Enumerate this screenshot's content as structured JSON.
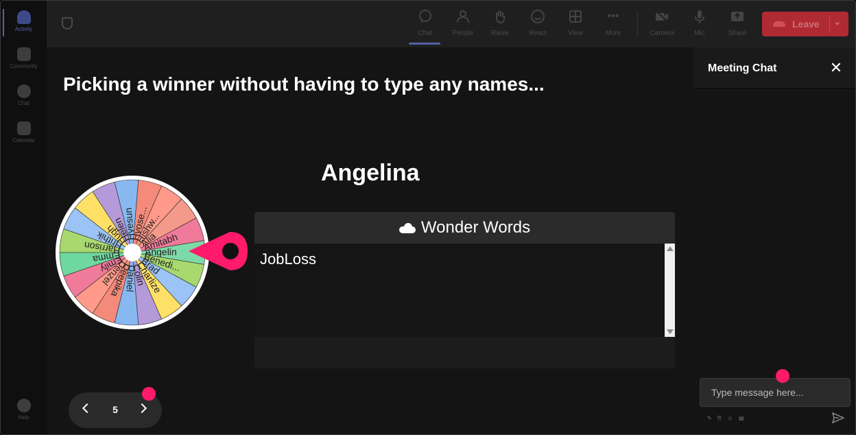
{
  "rail": {
    "items": [
      {
        "label": "Activity",
        "active": true
      },
      {
        "label": "Community"
      },
      {
        "label": "Chat"
      },
      {
        "label": "Calendar"
      }
    ],
    "help_label": "Help"
  },
  "toolbar": {
    "chat": "Chat",
    "people": "People",
    "raise": "Raise",
    "react": "React",
    "view": "View",
    "more": "More",
    "camera": "Camera",
    "mic": "Mic",
    "share": "Share",
    "leave": "Leave"
  },
  "stage": {
    "title": "Picking a winner without having to type any names...",
    "winner": "Angelina",
    "wheel": {
      "names": [
        "Angelin",
        "Benedi...",
        "Brad",
        "Charlize",
        "Colin",
        "Daniel",
        "Deepika",
        "Denzel",
        "Emily",
        "Emma",
        "Harrison",
        "Hrithik",
        "Hugh",
        "Helen",
        "Hyesun",
        "Hyose...",
        "Hishw...",
        "Alia",
        "Amitabh"
      ],
      "colors": [
        "#7ed9a8",
        "#a8d86e",
        "#9cc3f5",
        "#ffe066",
        "#b49ad8",
        "#88b8f0",
        "#f48a7a",
        "#ff9a8a",
        "#f07a9a",
        "#6ed8a0",
        "#a8d86e",
        "#9cc3f5",
        "#ffe066",
        "#b49ad8",
        "#88b8f0",
        "#f48a7a",
        "#ff9a8a",
        "#f49a8a",
        "#f07a9a"
      ],
      "pointer_color": "#ff1a6a"
    },
    "panel": {
      "title": "Wonder Words",
      "text": "JobLoss"
    },
    "pager": {
      "page": "5"
    }
  },
  "chat": {
    "title": "Meeting Chat",
    "placeholder": "Type message here...",
    "tools": "✎ ⎘ ☺ ▤"
  },
  "colors": {
    "accent": "#5660a8",
    "leave": "#b02a34",
    "highlight": "#ff1a6a"
  }
}
